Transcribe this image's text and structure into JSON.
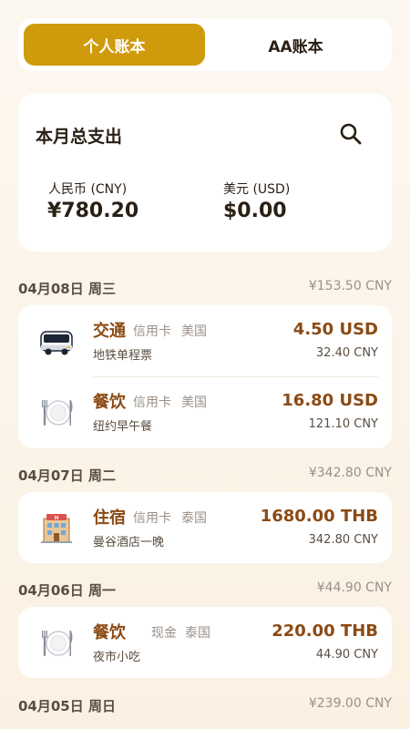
{
  "tabs": {
    "personal": "个人账本",
    "aa": "AA账本"
  },
  "summary": {
    "title": "本月总支出",
    "cny_label": "人民币 (CNY)",
    "cny_value": "¥780.20",
    "usd_label": "美元 (USD)",
    "usd_value": "$0.00"
  },
  "days": [
    {
      "date": "04月08日 周三",
      "total": "¥153.50 CNY",
      "entries": [
        {
          "icon": "bus-icon",
          "category": "交通",
          "payment": "信用卡",
          "country": "美国",
          "desc": "地铁单程票",
          "amount": "4.50 USD",
          "cny": "32.40 CNY"
        },
        {
          "icon": "dining-icon",
          "category": "餐饮",
          "payment": "信用卡",
          "country": "美国",
          "desc": "纽约早午餐",
          "amount": "16.80 USD",
          "cny": "121.10 CNY"
        }
      ]
    },
    {
      "date": "04月07日 周二",
      "total": "¥342.80 CNY",
      "entries": [
        {
          "icon": "hotel-icon",
          "category": "住宿",
          "payment": "信用卡",
          "country": "泰国",
          "desc": "曼谷酒店一晚",
          "amount": "1680.00 THB",
          "cny": "342.80 CNY"
        }
      ]
    },
    {
      "date": "04月06日 周一",
      "total": "¥44.90 CNY",
      "entries": [
        {
          "icon": "dining-icon",
          "category": "餐饮",
          "payment": "现金",
          "country": "泰国",
          "desc": "夜市小吃",
          "amount": "220.00 THB",
          "cny": "44.90 CNY"
        }
      ]
    },
    {
      "date": "04月05日 周日",
      "total": "¥239.00 CNY",
      "entries": []
    }
  ]
}
